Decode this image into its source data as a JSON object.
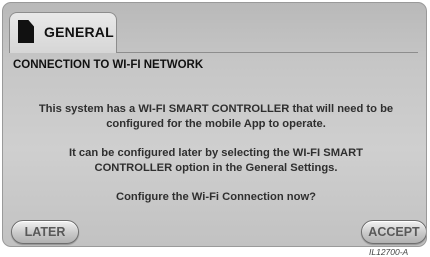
{
  "tab": {
    "label": "GENERAL",
    "icon": "document-icon"
  },
  "section": {
    "title": "CONNECTION TO WI-FI NETWORK"
  },
  "message": {
    "line1a": "This system has a WI-FI SMART CONTROLLER that will need to be",
    "line1b": "configured for the mobile App to operate.",
    "line2a": "It can be configured later by selecting the WI-FI SMART",
    "line2b": "CONTROLLER option in the General Settings.",
    "line3": "Configure the Wi-Fi Connection now?"
  },
  "buttons": {
    "later": "LATER",
    "accept": "ACCEPT"
  },
  "figure_ref": "IL12700-A"
}
